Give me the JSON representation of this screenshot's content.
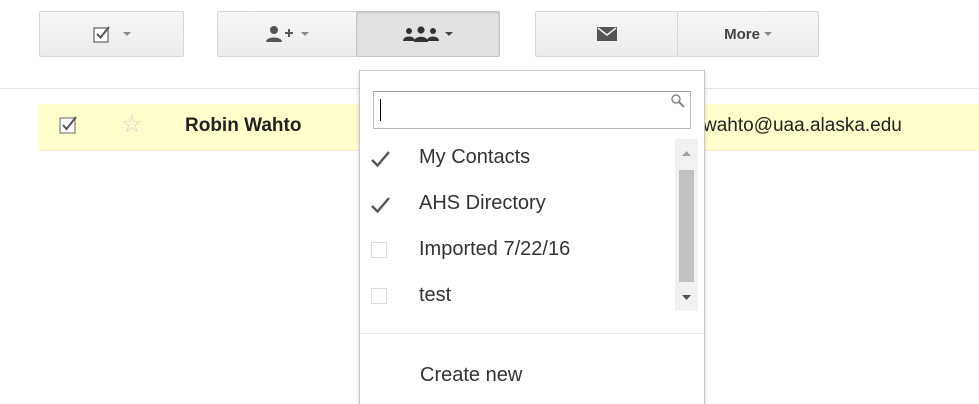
{
  "toolbar": {
    "select_icon": "checkbox-select-icon",
    "add_contact_icon": "add-person-icon",
    "groups_icon": "group-icon",
    "email_icon": "envelope-icon",
    "more_label": "More"
  },
  "contact_row": {
    "checked": true,
    "starred": false,
    "name": "Robin Wahto",
    "email_visible": "wahto@uaa.alaska.edu",
    "highlight_color": "#ffffcc"
  },
  "groups_menu": {
    "search": {
      "value": "",
      "placeholder": ""
    },
    "items": [
      {
        "label": "My Contacts",
        "checked": true
      },
      {
        "label": "AHS Directory",
        "checked": true
      },
      {
        "label": "Imported 7/22/16",
        "checked": false
      },
      {
        "label": "test",
        "checked": false
      }
    ],
    "create_new_label": "Create new"
  }
}
